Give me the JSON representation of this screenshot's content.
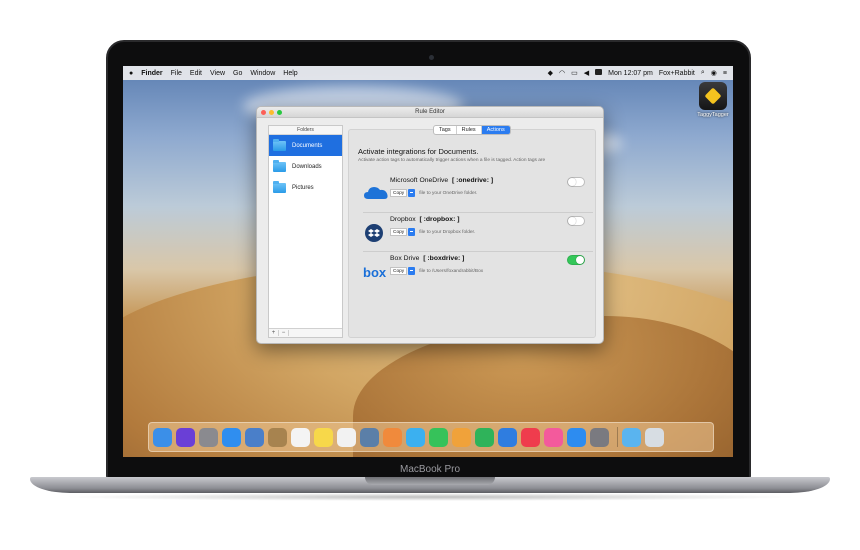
{
  "device": {
    "label": "MacBook Pro"
  },
  "menubar": {
    "apple": "",
    "items": [
      "Finder",
      "File",
      "Edit",
      "View",
      "Go",
      "Window",
      "Help"
    ],
    "clock": "Mon 12:07 pm",
    "user": "Fox+Rabbit"
  },
  "desktop_icon": {
    "label": "TaggyTagger",
    "icon": "tag-icon"
  },
  "window": {
    "title": "Rule Editor",
    "sidebar": {
      "header": "Folders",
      "items": [
        {
          "label": "Documents",
          "selected": true
        },
        {
          "label": "Downloads",
          "selected": false
        },
        {
          "label": "Pictures",
          "selected": false
        }
      ],
      "add": "+",
      "remove": "−"
    },
    "tabs": [
      {
        "label": "Tags",
        "active": false
      },
      {
        "label": "Rules",
        "active": false
      },
      {
        "label": "Actions",
        "active": true
      }
    ],
    "heading": "Activate integrations for Documents.",
    "subheading": "Activate action tags to automatically trigger actions when a file is tagged. Action tags are",
    "services": [
      {
        "name": "Microsoft OneDrive",
        "tag": "[ :onedrive: ]",
        "action": "Copy",
        "desc": "file to your OneDrive folder.",
        "enabled": false,
        "icon": "onedrive-cloud-icon"
      },
      {
        "name": "Dropbox",
        "tag": "[ :dropbox: ]",
        "action": "Copy",
        "desc": "file to your Dropbox folder.",
        "enabled": false,
        "icon": "dropbox-icon"
      },
      {
        "name": "Box Drive",
        "tag": "[ :boxdrive: ]",
        "action": "Copy",
        "desc": "file to /Users/foxandrabbit/Box",
        "enabled": true,
        "icon": "box-logo-icon"
      }
    ]
  },
  "dock": {
    "apps": [
      {
        "name": "finder-icon",
        "color": "#3b8fe8"
      },
      {
        "name": "siri-icon",
        "color": "#6a3fd6"
      },
      {
        "name": "launchpad-icon",
        "color": "#8a8a8f"
      },
      {
        "name": "safari-icon",
        "color": "#2f8ef0"
      },
      {
        "name": "photo-preview-icon",
        "color": "#4a7fc9"
      },
      {
        "name": "contacts-icon",
        "color": "#a7834f"
      },
      {
        "name": "calendar-icon",
        "color": "#f4f4f4"
      },
      {
        "name": "notes-icon",
        "color": "#f7d84a"
      },
      {
        "name": "reminders-icon",
        "color": "#f2f2f2"
      },
      {
        "name": "photo-booth-icon",
        "color": "#5b7fa8"
      },
      {
        "name": "photos-icon",
        "color": "#f08a3c"
      },
      {
        "name": "messages-icon",
        "color": "#3bb0f0"
      },
      {
        "name": "facetime-icon",
        "color": "#36c25a"
      },
      {
        "name": "pages-icon",
        "color": "#f0a23a"
      },
      {
        "name": "numbers-icon",
        "color": "#2fb35a"
      },
      {
        "name": "keynote-icon",
        "color": "#2f7de0"
      },
      {
        "name": "news-icon",
        "color": "#ef3c4d"
      },
      {
        "name": "music-icon",
        "color": "#f35a9c"
      },
      {
        "name": "app-store-icon",
        "color": "#2d8cf0"
      },
      {
        "name": "system-preferences-icon",
        "color": "#7a7a80"
      }
    ],
    "extras": [
      {
        "name": "downloads-folder-icon",
        "color": "#5ab4ef"
      },
      {
        "name": "trash-icon",
        "color": "#d7dde3"
      }
    ]
  }
}
